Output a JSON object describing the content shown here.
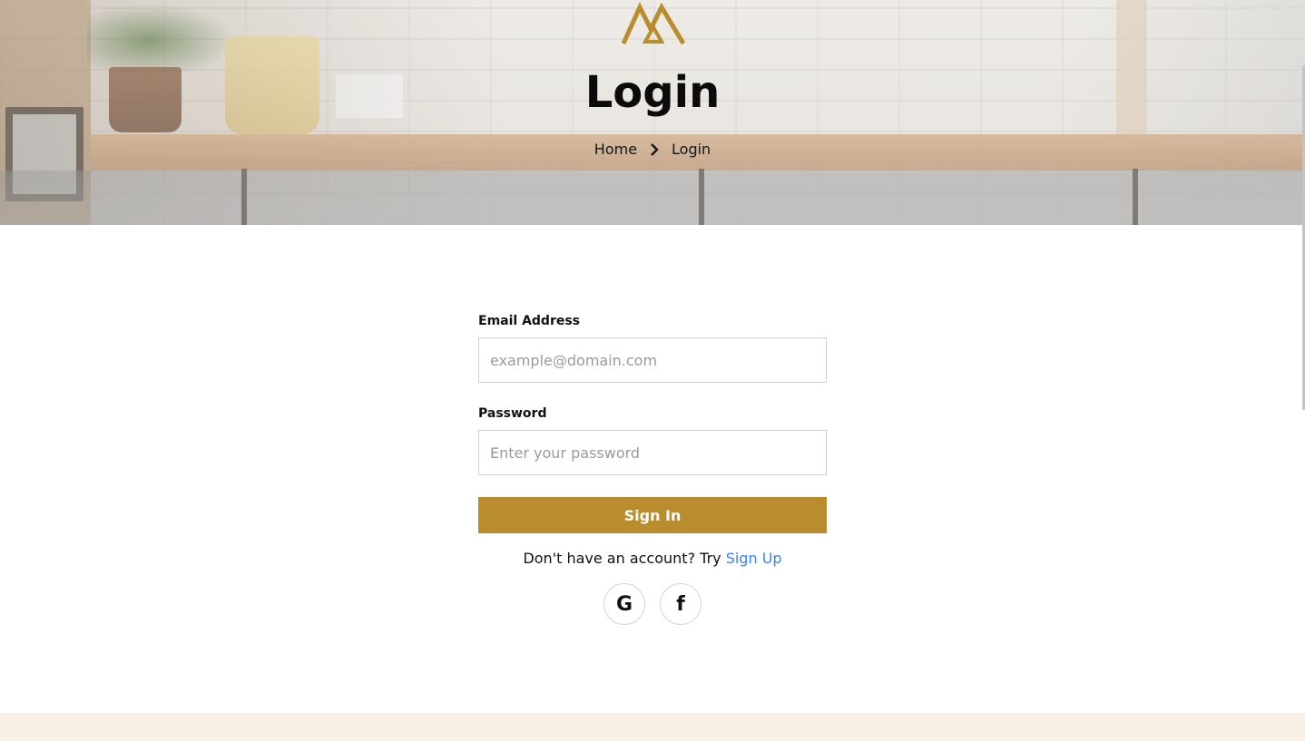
{
  "hero": {
    "title": "Login",
    "breadcrumb": {
      "home": "Home",
      "current": "Login"
    }
  },
  "form": {
    "email": {
      "label": "Email Address",
      "placeholder": "example@domain.com",
      "value": ""
    },
    "password": {
      "label": "Password",
      "placeholder": "Enter your password",
      "value": ""
    },
    "submit_label": "Sign In",
    "signup_prompt": "Don't have an account? Try",
    "signup_link": "Sign Up"
  },
  "social": [
    {
      "icon": "google-icon",
      "glyph": "G"
    },
    {
      "icon": "facebook-icon",
      "glyph": "f"
    }
  ],
  "colors": {
    "accent": "#b98d2e",
    "link": "#3b82f6",
    "footer_band": "#f8f0e6"
  }
}
